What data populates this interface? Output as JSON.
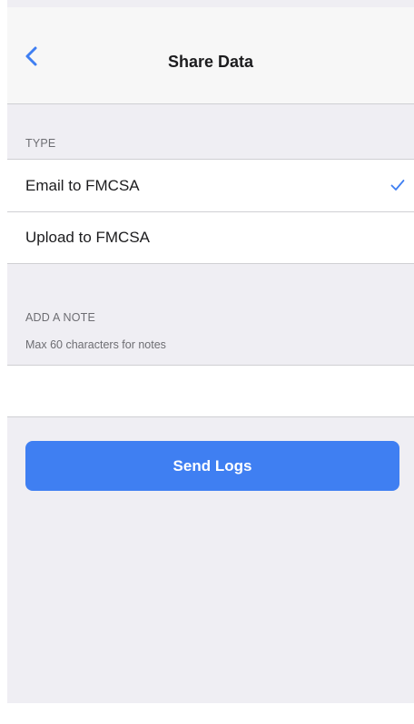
{
  "navbar": {
    "back_icon": "chevron-left-icon",
    "title": "Share Data"
  },
  "type_section": {
    "header": "TYPE",
    "options": [
      {
        "label": "Email to FMCSA",
        "selected": true
      },
      {
        "label": "Upload to FMCSA",
        "selected": false
      }
    ],
    "check_icon": "checkmark-icon"
  },
  "note_section": {
    "header": "ADD A NOTE",
    "subtitle": "Max 60 characters for notes",
    "value": "",
    "placeholder": ""
  },
  "send_button": {
    "label": "Send Logs"
  },
  "colors": {
    "accent": "#3f7ff2",
    "background": "#efeef3",
    "navbar": "#f7f7f7"
  }
}
